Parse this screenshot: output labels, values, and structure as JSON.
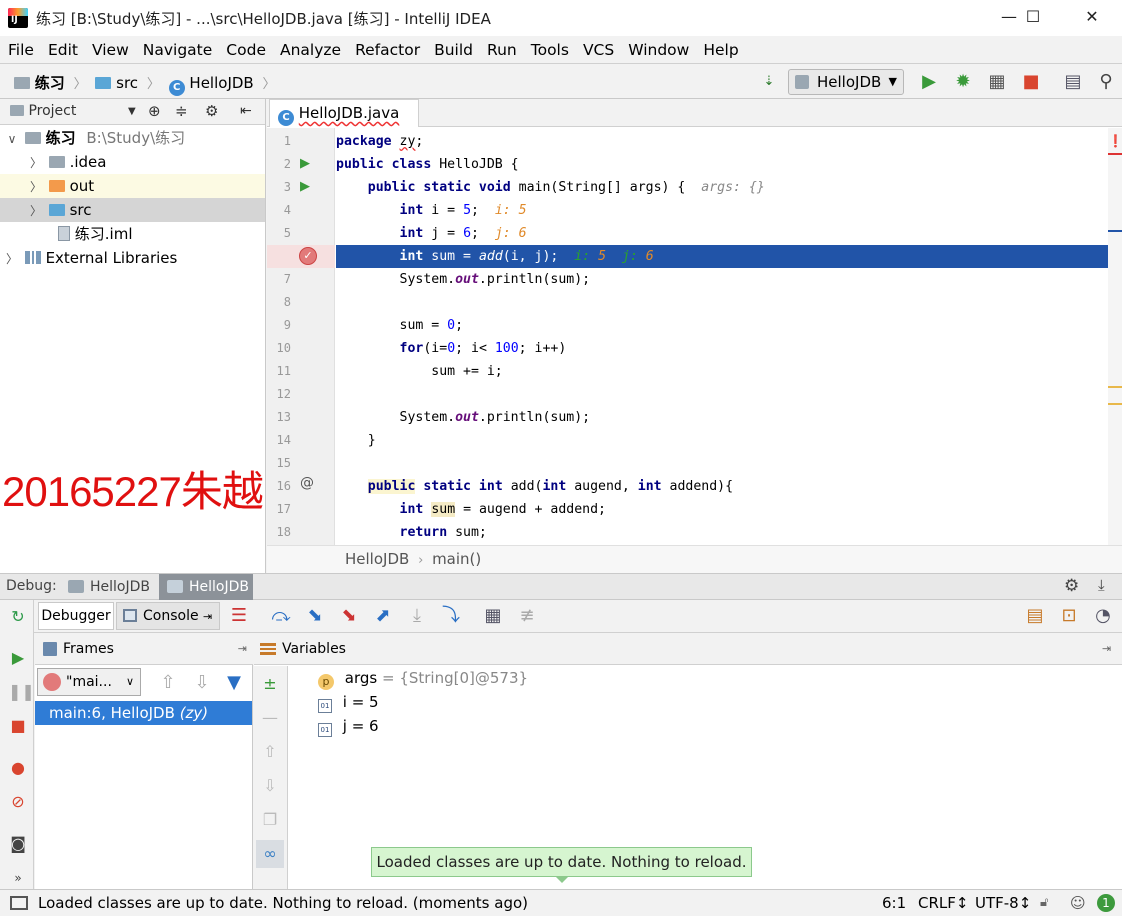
{
  "window": {
    "title": "练习 [B:\\Study\\练习] - ...\\src\\HelloJDB.java [练习] - IntelliJ IDEA",
    "minimize": "—",
    "maximize": "☐",
    "close": "✕"
  },
  "menu": [
    "File",
    "Edit",
    "View",
    "Navigate",
    "Code",
    "Analyze",
    "Refactor",
    "Build",
    "Run",
    "Tools",
    "VCS",
    "Window",
    "Help"
  ],
  "breadcrumb": {
    "project": "练习",
    "folder": "src",
    "file": "HelloJDB"
  },
  "run_config": "HelloJDB",
  "project_panel": {
    "title": "Project",
    "tree": [
      {
        "label": "练习",
        "path": "B:\\Study\\练习"
      },
      {
        "label": ".idea"
      },
      {
        "label": "out"
      },
      {
        "label": "src"
      },
      {
        "label": "练习.iml"
      },
      {
        "label": "External Libraries"
      }
    ]
  },
  "editor": {
    "tab": "HelloJDB.java",
    "line_numbers": [
      "1",
      "2",
      "3",
      "4",
      "5",
      "6",
      "7",
      "8",
      "9",
      "10",
      "11",
      "12",
      "13",
      "14",
      "15",
      "16",
      "17",
      "18"
    ],
    "breadcrumb": {
      "class": "HelloJDB",
      "method": "main()"
    }
  },
  "watermark": "20165227朱越",
  "debug": {
    "label": "Debug:",
    "tabs": [
      "HelloJDB",
      "HelloJDB"
    ],
    "subtabs": {
      "debugger": "Debugger",
      "console": "Console"
    },
    "frames": {
      "title": "Frames",
      "thread": "\"mai...",
      "items": [
        {
          "method": "main:6, HelloJDB",
          "pkg": "(zy)"
        }
      ]
    },
    "variables": {
      "title": "Variables",
      "items": [
        {
          "name": "args",
          "value": " = {String[0]@573}"
        },
        {
          "name": "i",
          "value": " = 5"
        },
        {
          "name": "j",
          "value": " = 6"
        }
      ]
    }
  },
  "toast": "Loaded classes are up to date. Nothing to reload.",
  "status": {
    "message": "Loaded classes are up to date. Nothing to reload. (moments ago)",
    "position": "6:1",
    "line_ending": "CRLF↕",
    "encoding": "UTF-8↕",
    "notifications": "1"
  }
}
